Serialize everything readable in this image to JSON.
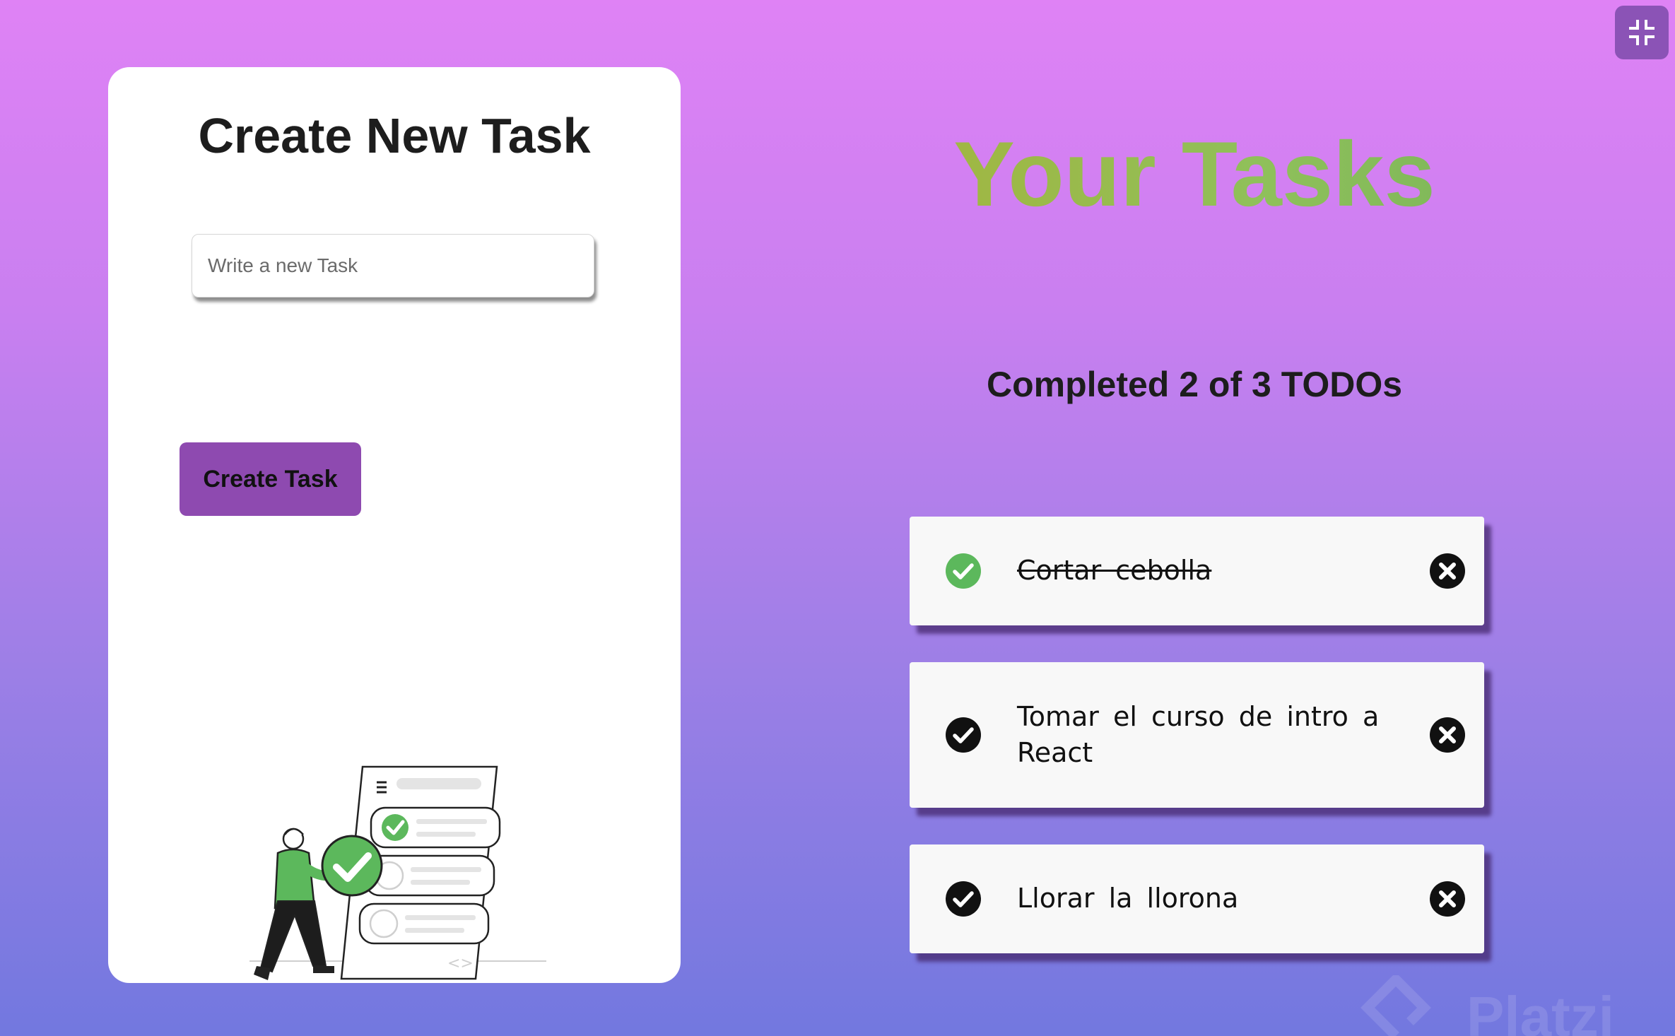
{
  "create": {
    "title": "Create New Task",
    "input_placeholder": "Write a new Task",
    "input_value": "",
    "button_label": "Create Task"
  },
  "tasks": {
    "title": "Your Tasks",
    "counter": "Completed 2 of 3 TODOs",
    "items": [
      {
        "text": "Cortar cebolla",
        "completed": true
      },
      {
        "text": "Tomar el curso de intro a React",
        "completed": false
      },
      {
        "text": "Llorar la llorona",
        "completed": false
      }
    ]
  },
  "watermark": {
    "text": "Platzi"
  },
  "icons": {
    "check": "check-circle-icon",
    "delete": "close-circle-icon",
    "fullscreen": "exit-fullscreen-icon"
  },
  "colors": {
    "check_completed": "#5cb85c",
    "check_pending": "#111111",
    "button": "#8e4ab0",
    "title_gradient_start": "#a5b43c",
    "title_gradient_end": "#7ab55a"
  }
}
